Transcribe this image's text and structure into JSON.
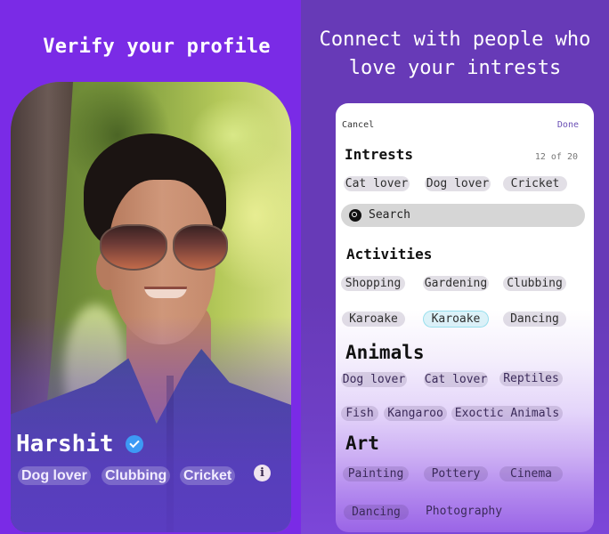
{
  "colors": {
    "left_bg": "#7a2be6",
    "right_bg": "#673ab7",
    "done_accent": "#6a4fb5",
    "verified_badge": "#3d9af5",
    "selected_chip_border": "#8cdceb"
  },
  "left_panel": {
    "title": "Verify your profile",
    "profile": {
      "photo": "profile-photo-man-sunglasses",
      "name": "Harshit",
      "verified_icon": "verified-check-icon",
      "tags": [
        "Dog lover",
        "Clubbing",
        "Cricket"
      ],
      "info_icon": "info-icon",
      "info_glyph": "i"
    }
  },
  "right_panel": {
    "title_line1": "Connect with people who",
    "title_line2": "love your intrests",
    "card": {
      "cancel_label": "Cancel",
      "done_label": "Done",
      "interests": {
        "heading": "Intrests",
        "count": "12 of 20",
        "chips": [
          "Cat lover",
          "Dog lover",
          "Cricket"
        ]
      },
      "search": {
        "icon": "search-icon",
        "placeholder": "Search"
      },
      "sections": [
        {
          "heading": "Activities",
          "chips": [
            {
              "label": "Shopping"
            },
            {
              "label": "Gardening"
            },
            {
              "label": "Clubbing"
            },
            {
              "label": "Karoake"
            },
            {
              "label": "Karoake",
              "selected": true
            },
            {
              "label": "Dancing"
            }
          ]
        },
        {
          "heading": "Animals",
          "chips": [
            {
              "label": "Dog lover"
            },
            {
              "label": "Cat lover"
            },
            {
              "label": "Reptiles"
            },
            {
              "label": "Fish"
            },
            {
              "label": "Kangaroo"
            },
            {
              "label": "Exoctic Animals"
            }
          ]
        },
        {
          "heading": "Art",
          "chips": [
            {
              "label": "Painting"
            },
            {
              "label": "Pottery"
            },
            {
              "label": "Cinema"
            },
            {
              "label": "Dancing"
            },
            {
              "label": "Photography"
            }
          ]
        }
      ]
    }
  }
}
